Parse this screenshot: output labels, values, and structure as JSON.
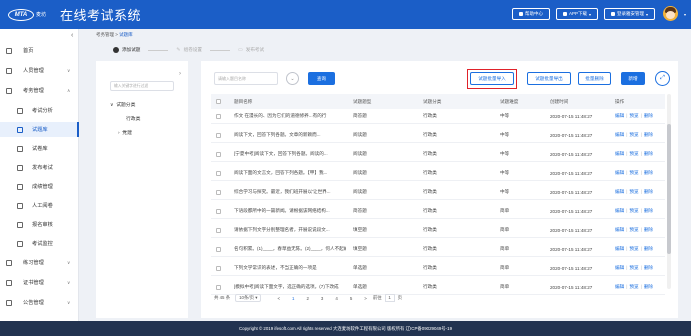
{
  "header": {
    "logo_text": "MTA",
    "logo_name": "麦坊",
    "app_title": "在线考试系统",
    "buttons": [
      {
        "label": "帮助中心",
        "icon": "help-icon"
      },
      {
        "label": "APP下载",
        "icon": "download-icon"
      },
      {
        "label": "登录雅安管理",
        "icon": "user-icon"
      }
    ],
    "avatar": "user-avatar"
  },
  "sidebar": {
    "items": [
      {
        "label": "首页",
        "icon": "home-icon",
        "level": 1
      },
      {
        "label": "人员管理",
        "icon": "person-icon",
        "level": 1,
        "arrow": "∨"
      },
      {
        "label": "考务管理",
        "icon": "exam-affairs-icon",
        "level": 1,
        "arrow": "∧"
      },
      {
        "label": "考试分析",
        "icon": "analysis-icon",
        "level": 2
      },
      {
        "label": "试题库",
        "icon": "question-bank-icon",
        "level": 2,
        "active": true
      },
      {
        "label": "试卷库",
        "icon": "paper-icon",
        "level": 2
      },
      {
        "label": "发布考试",
        "icon": "publish-icon",
        "level": 2
      },
      {
        "label": "成绩管理",
        "icon": "score-icon",
        "level": 2
      },
      {
        "label": "人工阅卷",
        "icon": "grading-icon",
        "level": 2
      },
      {
        "label": "报名审核",
        "icon": "review-icon",
        "level": 2
      },
      {
        "label": "考试监控",
        "icon": "monitor-icon",
        "level": 2
      },
      {
        "label": "练习管理",
        "icon": "practice-icon",
        "level": 1,
        "arrow": "∨"
      },
      {
        "label": "证书管理",
        "icon": "certificate-icon",
        "level": 1,
        "arrow": "∨"
      },
      {
        "label": "公告管理",
        "icon": "notice-icon",
        "level": 1,
        "arrow": "∨"
      }
    ]
  },
  "breadcrumb": {
    "parent": "考务管理",
    "sep": ">",
    "current": "试题库"
  },
  "steps": [
    {
      "label": "添加试题",
      "active": true
    },
    {
      "label": "组卷设置",
      "active": false
    },
    {
      "label": "发布考试",
      "active": false
    }
  ],
  "tree": {
    "search_placeholder": "输入关键字进行过滤",
    "root": "试题分类",
    "children": [
      "行政类",
      "党建"
    ]
  },
  "toolbar": {
    "search_placeholder": "请输入题目名称",
    "query": "查询",
    "batch_import": "试题批量导入",
    "batch_export": "试题批量导出",
    "batch_delete": "批量删除",
    "add": "新增"
  },
  "table": {
    "columns": [
      "题目名称",
      "试题题型",
      "试题分类",
      "试题难度",
      "创建时间",
      "操作"
    ],
    "ops": [
      "编辑",
      "预览",
      "删除"
    ],
    "rows": [
      {
        "name": "作文 在漫长的、因为它们的道德修养...有的行",
        "type": "简答题",
        "category": "行政类",
        "difficulty": "中等",
        "time": "2020-07-15 11:48:27"
      },
      {
        "name": "阅读下文，回答下列各题。文章的新颖而...",
        "type": "阅读题",
        "category": "行政类",
        "difficulty": "中等",
        "time": "2020-07-15 11:48:27"
      },
      {
        "name": "[宁夏中考]阅读下文，回答下列各题。阅读的...",
        "type": "阅读题",
        "category": "行政类",
        "difficulty": "中等",
        "time": "2020-07-15 11:48:27"
      },
      {
        "name": "阅读下面的文言文，回答下列各题。【甲】我...",
        "type": "阅读题",
        "category": "行政类",
        "difficulty": "中等",
        "time": "2020-07-15 11:48:27"
      },
      {
        "name": "综合学习与探究。最近，我们班开展以'让世界...",
        "type": "阅读题",
        "category": "行政类",
        "difficulty": "中等",
        "time": "2020-07-15 11:48:27"
      },
      {
        "name": "下语段都所中的一篇新闻。请根据该网络结构...",
        "type": "简答题",
        "category": "行政类",
        "difficulty": "简单",
        "time": "2020-07-15 11:48:27"
      },
      {
        "name": "请依据下列文字分别整理名者，开展说说段文...",
        "type": "填空题",
        "category": "行政类",
        "difficulty": "简单",
        "time": "2020-07-15 11:48:27"
      },
      {
        "name": "名句积累。(1)____，春草益无陈。(2)____，何人不起故园情",
        "type": "填空题",
        "category": "行政类",
        "difficulty": "简单",
        "time": "2020-07-15 11:48:27"
      },
      {
        "name": "下列文学常识的表述，不当正确的一项是",
        "type": "单选题",
        "category": "行政类",
        "difficulty": "简单",
        "time": "2020-07-15 11:48:27"
      },
      {
        "name": "[模拟中考]阅读下面文字，选正确的选项。(7)下改成",
        "type": "单选题",
        "category": "行政类",
        "difficulty": "简单",
        "time": "2020-07-15 11:48:27"
      }
    ]
  },
  "pager": {
    "total": "共 45 条",
    "page_size": "10条/页",
    "prev": "<",
    "pages": [
      "1",
      "2",
      "3",
      "4",
      "5"
    ],
    "current_page": "1",
    "next": ">",
    "goto_label": "前往",
    "goto_value": "1",
    "page_unit": "页"
  },
  "footer": {
    "text": "Copyright © 2019 ifesoft.com All rights reserved 大连麦坊软件工程有限公司 版权所有 辽ICP备09029049号-19"
  },
  "colors": {
    "brand": "#1b5ec7",
    "button": "#1b6fe0",
    "highlight": "#e0222a",
    "footer": "#223350"
  }
}
